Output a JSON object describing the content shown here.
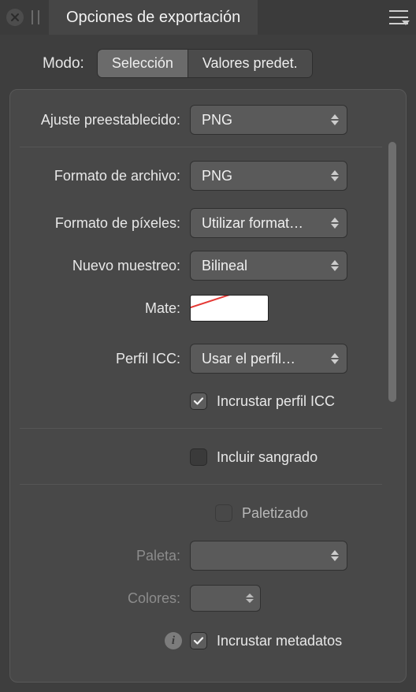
{
  "titlebar": {
    "tab_title": "Opciones de exportación"
  },
  "mode": {
    "label": "Modo:",
    "options": [
      "Selección",
      "Valores predet."
    ],
    "active_index": 0
  },
  "form": {
    "preset": {
      "label": "Ajuste preestablecido:",
      "value": "PNG"
    },
    "file_format": {
      "label": "Formato de archivo:",
      "value": "PNG"
    },
    "pixel_format": {
      "label": "Formato de píxeles:",
      "value": "Utilizar format…"
    },
    "resample": {
      "label": "Nuevo muestreo:",
      "value": "Bilineal"
    },
    "matte": {
      "label": "Mate:"
    },
    "icc_profile": {
      "label": "Perfil ICC:",
      "value": "Usar el perfil…"
    },
    "embed_icc": {
      "label": "Incrustar perfil ICC",
      "checked": true
    },
    "include_bleed": {
      "label": "Incluir sangrado",
      "checked": false
    },
    "palettized": {
      "label": "Paletizado",
      "checked": false
    },
    "palette": {
      "label": "Paleta:",
      "value": ""
    },
    "colors": {
      "label": "Colores:",
      "value": ""
    },
    "embed_meta": {
      "label": "Incrustar metadatos",
      "checked": true
    }
  }
}
